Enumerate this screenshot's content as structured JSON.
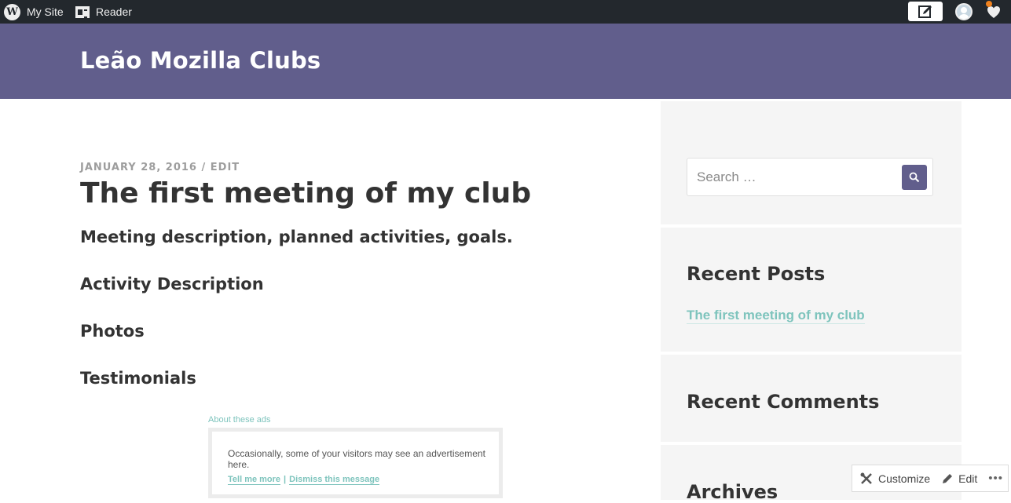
{
  "masterbar": {
    "my_site_label": "My Site",
    "reader_label": "Reader",
    "icons": [
      "wordpress-logo-icon",
      "reader-icon",
      "write-post-icon",
      "avatar-icon",
      "notifications-icon"
    ],
    "notification_indicator_color": "#f0821e"
  },
  "header": {
    "site_title": "Leão Mozilla Clubs",
    "background_color": "#615e8c"
  },
  "post": {
    "date": "JANUARY 28, 2016",
    "separator": "/",
    "edit_label": "EDIT",
    "title": "The first meeting of my club",
    "description": "Meeting description, planned activities, goals.",
    "sections": [
      "Activity Description",
      "Photos",
      "Testimonials"
    ]
  },
  "ad": {
    "about_label": "About these ads",
    "message": "Occasionally, some of your visitors may see an advertisement here.",
    "tell_me_more": "Tell me more",
    "separator": "|",
    "dismiss": "Dismiss this message"
  },
  "sidebar": {
    "search_placeholder": "Search …",
    "recent_posts_title": "Recent Posts",
    "recent_posts": [
      "The first meeting of my club"
    ],
    "recent_comments_title": "Recent Comments",
    "archives_title": "Archives",
    "link_color": "#7ec4bd"
  },
  "customizer": {
    "customize_label": "Customize",
    "edit_label": "Edit",
    "more_label": "•••"
  }
}
